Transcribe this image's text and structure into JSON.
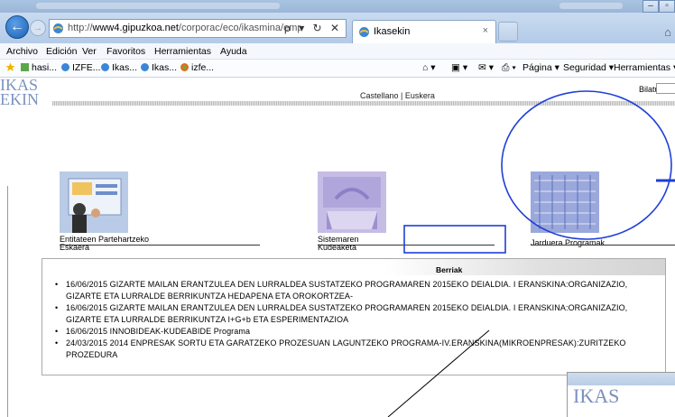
{
  "browser": {
    "address": {
      "prefix": "http://",
      "host": "www4.gipuzkoa.net",
      "path": "/corporac/eco/ikasmina/emprendizaj",
      "icons": "ρ ▾ ↻ ✕"
    },
    "tab": {
      "title": "Ikasekin",
      "close": "×"
    },
    "menu": [
      "Archivo",
      "Edición",
      "Ver",
      "Favoritos",
      "Herramientas",
      "Ayuda"
    ],
    "favorites": [
      "hasi...",
      "IZFE...",
      "Ikas...",
      "Ikas...",
      "izfe..."
    ],
    "commands": [
      "Página ▾",
      "Seguridad ▾",
      "Herramientas ▾"
    ]
  },
  "site": {
    "logo_line1": "IKAS",
    "logo_line2": "EKIN",
    "languages": "Castellano  |  Euskera",
    "search_label": "Bilatu:"
  },
  "tiles": [
    {
      "line1": "Entitateen Partehartzeko",
      "line2": "Eskaera"
    },
    {
      "line1": "Sistemaren",
      "line2": "Kudeaketa"
    },
    {
      "line1": "Jarduera Programak",
      "line2": ""
    }
  ],
  "news": {
    "title": "Berriak",
    "items": [
      "16/06/2015    GIZARTE MAILAN ERANTZULEA DEN LURRALDEA SUSTATZEKO PROGRAMAREN 2015EKO DEIALDIA. I ERANSKINA:ORGANIZAZIO, GIZARTE ETA LURRALDE BERRIKUNTZA HEDAPENA ETA OROKORTZEA-",
      "16/06/2015    GIZARTE MAILAN ERANTZULEA DEN LURRALDEA SUSTATZEKO PROGRAMAREN 2015EKO DEIALDIA. I ERANSKINA:ORGANIZAZIO, GIZARTE ETA LURRALDE BERRIKUNTZA I+G+b ETA ESPERIMENTAZIOA",
      "16/06/2015    INNOBIDEAK-KUDEABIDE Programa",
      "24/03/2015    2014 ENPRESAK SORTU ETA GARATZEKO PROZESUAN LAGUNTZEKO PROGRAMA-IV.ERANSKINA(MIKROENPRESAK):ZURITZEKO PROZEDURA"
    ]
  },
  "thumbnail": {
    "logo": "IKAS"
  },
  "colors": {
    "annotation": "#1f3fd6",
    "logo": "#7c93c2"
  }
}
